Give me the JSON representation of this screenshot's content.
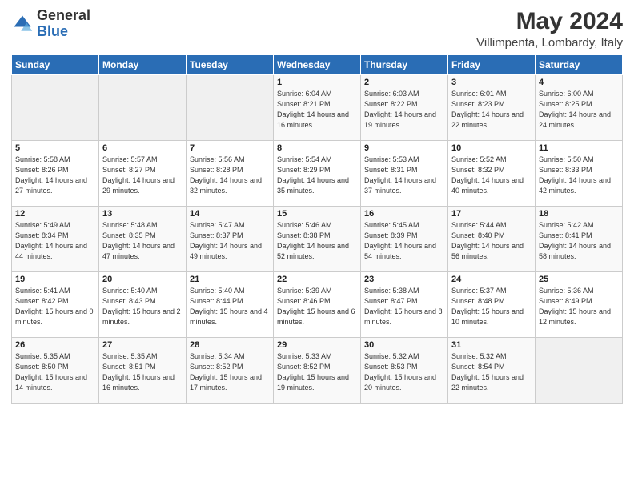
{
  "logo": {
    "general": "General",
    "blue": "Blue"
  },
  "header": {
    "month_title": "May 2024",
    "subtitle": "Villimpenta, Lombardy, Italy"
  },
  "weekdays": [
    "Sunday",
    "Monday",
    "Tuesday",
    "Wednesday",
    "Thursday",
    "Friday",
    "Saturday"
  ],
  "weeks": [
    [
      {
        "day": "",
        "sunrise": "",
        "sunset": "",
        "daylight": ""
      },
      {
        "day": "",
        "sunrise": "",
        "sunset": "",
        "daylight": ""
      },
      {
        "day": "",
        "sunrise": "",
        "sunset": "",
        "daylight": ""
      },
      {
        "day": "1",
        "sunrise": "6:04 AM",
        "sunset": "8:21 PM",
        "daylight": "14 hours and 16 minutes."
      },
      {
        "day": "2",
        "sunrise": "6:03 AM",
        "sunset": "8:22 PM",
        "daylight": "14 hours and 19 minutes."
      },
      {
        "day": "3",
        "sunrise": "6:01 AM",
        "sunset": "8:23 PM",
        "daylight": "14 hours and 22 minutes."
      },
      {
        "day": "4",
        "sunrise": "6:00 AM",
        "sunset": "8:25 PM",
        "daylight": "14 hours and 24 minutes."
      }
    ],
    [
      {
        "day": "5",
        "sunrise": "5:58 AM",
        "sunset": "8:26 PM",
        "daylight": "14 hours and 27 minutes."
      },
      {
        "day": "6",
        "sunrise": "5:57 AM",
        "sunset": "8:27 PM",
        "daylight": "14 hours and 29 minutes."
      },
      {
        "day": "7",
        "sunrise": "5:56 AM",
        "sunset": "8:28 PM",
        "daylight": "14 hours and 32 minutes."
      },
      {
        "day": "8",
        "sunrise": "5:54 AM",
        "sunset": "8:29 PM",
        "daylight": "14 hours and 35 minutes."
      },
      {
        "day": "9",
        "sunrise": "5:53 AM",
        "sunset": "8:31 PM",
        "daylight": "14 hours and 37 minutes."
      },
      {
        "day": "10",
        "sunrise": "5:52 AM",
        "sunset": "8:32 PM",
        "daylight": "14 hours and 40 minutes."
      },
      {
        "day": "11",
        "sunrise": "5:50 AM",
        "sunset": "8:33 PM",
        "daylight": "14 hours and 42 minutes."
      }
    ],
    [
      {
        "day": "12",
        "sunrise": "5:49 AM",
        "sunset": "8:34 PM",
        "daylight": "14 hours and 44 minutes."
      },
      {
        "day": "13",
        "sunrise": "5:48 AM",
        "sunset": "8:35 PM",
        "daylight": "14 hours and 47 minutes."
      },
      {
        "day": "14",
        "sunrise": "5:47 AM",
        "sunset": "8:37 PM",
        "daylight": "14 hours and 49 minutes."
      },
      {
        "day": "15",
        "sunrise": "5:46 AM",
        "sunset": "8:38 PM",
        "daylight": "14 hours and 52 minutes."
      },
      {
        "day": "16",
        "sunrise": "5:45 AM",
        "sunset": "8:39 PM",
        "daylight": "14 hours and 54 minutes."
      },
      {
        "day": "17",
        "sunrise": "5:44 AM",
        "sunset": "8:40 PM",
        "daylight": "14 hours and 56 minutes."
      },
      {
        "day": "18",
        "sunrise": "5:42 AM",
        "sunset": "8:41 PM",
        "daylight": "14 hours and 58 minutes."
      }
    ],
    [
      {
        "day": "19",
        "sunrise": "5:41 AM",
        "sunset": "8:42 PM",
        "daylight": "15 hours and 0 minutes."
      },
      {
        "day": "20",
        "sunrise": "5:40 AM",
        "sunset": "8:43 PM",
        "daylight": "15 hours and 2 minutes."
      },
      {
        "day": "21",
        "sunrise": "5:40 AM",
        "sunset": "8:44 PM",
        "daylight": "15 hours and 4 minutes."
      },
      {
        "day": "22",
        "sunrise": "5:39 AM",
        "sunset": "8:46 PM",
        "daylight": "15 hours and 6 minutes."
      },
      {
        "day": "23",
        "sunrise": "5:38 AM",
        "sunset": "8:47 PM",
        "daylight": "15 hours and 8 minutes."
      },
      {
        "day": "24",
        "sunrise": "5:37 AM",
        "sunset": "8:48 PM",
        "daylight": "15 hours and 10 minutes."
      },
      {
        "day": "25",
        "sunrise": "5:36 AM",
        "sunset": "8:49 PM",
        "daylight": "15 hours and 12 minutes."
      }
    ],
    [
      {
        "day": "26",
        "sunrise": "5:35 AM",
        "sunset": "8:50 PM",
        "daylight": "15 hours and 14 minutes."
      },
      {
        "day": "27",
        "sunrise": "5:35 AM",
        "sunset": "8:51 PM",
        "daylight": "15 hours and 16 minutes."
      },
      {
        "day": "28",
        "sunrise": "5:34 AM",
        "sunset": "8:52 PM",
        "daylight": "15 hours and 17 minutes."
      },
      {
        "day": "29",
        "sunrise": "5:33 AM",
        "sunset": "8:52 PM",
        "daylight": "15 hours and 19 minutes."
      },
      {
        "day": "30",
        "sunrise": "5:32 AM",
        "sunset": "8:53 PM",
        "daylight": "15 hours and 20 minutes."
      },
      {
        "day": "31",
        "sunrise": "5:32 AM",
        "sunset": "8:54 PM",
        "daylight": "15 hours and 22 minutes."
      },
      {
        "day": "",
        "sunrise": "",
        "sunset": "",
        "daylight": ""
      }
    ]
  ]
}
